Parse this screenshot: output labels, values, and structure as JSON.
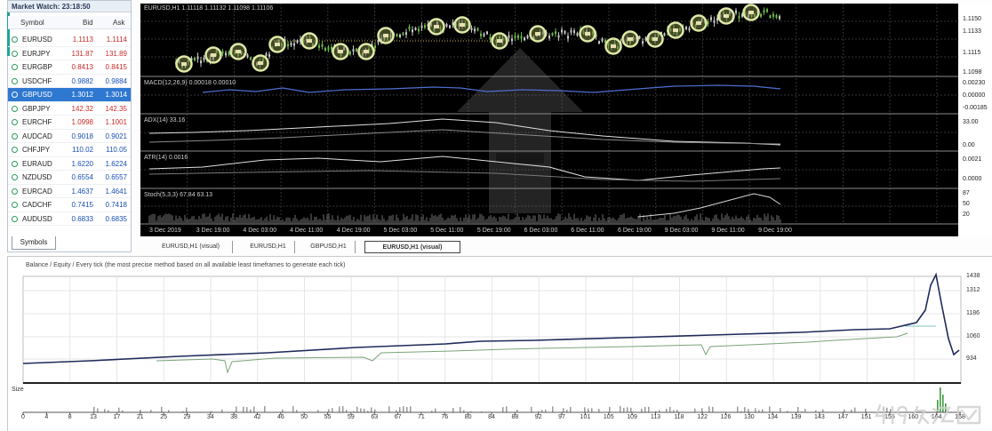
{
  "market_watch": {
    "title": "Market Watch: 23:18:50",
    "columns": {
      "symbol": "Symbol",
      "bid": "Bid",
      "ask": "Ask"
    },
    "colors": {
      "up": "#1a4fb5",
      "down": "#cc2b2b",
      "selected": "#2f78d1"
    },
    "icon_color": "#2e9b5b",
    "rows": [
      {
        "symbol": "EURUSD",
        "bid": "1.1113",
        "ask": "1.1114",
        "tick": "down"
      },
      {
        "symbol": "EURJPY",
        "bid": "131.87",
        "ask": "131.89",
        "tick": "down"
      },
      {
        "symbol": "EURGBP",
        "bid": "0.8413",
        "ask": "0.8415",
        "tick": "down"
      },
      {
        "symbol": "USDCHF",
        "bid": "0.9882",
        "ask": "0.9884",
        "tick": "up"
      },
      {
        "symbol": "GBPUSD",
        "bid": "1.3012",
        "ask": "1.3014",
        "tick": "up",
        "selected": true
      },
      {
        "symbol": "GBPJPY",
        "bid": "142.32",
        "ask": "142.35",
        "tick": "down"
      },
      {
        "symbol": "EURCHF",
        "bid": "1.0998",
        "ask": "1.1001",
        "tick": "down"
      },
      {
        "symbol": "AUDCAD",
        "bid": "0.9018",
        "ask": "0.9021",
        "tick": "up"
      },
      {
        "symbol": "CHFJPY",
        "bid": "110.02",
        "ask": "110.05",
        "tick": "up"
      },
      {
        "symbol": "EURAUD",
        "bid": "1.6220",
        "ask": "1.6224",
        "tick": "up"
      },
      {
        "symbol": "NZDUSD",
        "bid": "0.6554",
        "ask": "0.6557",
        "tick": "up"
      },
      {
        "symbol": "EURCAD",
        "bid": "1.4637",
        "ask": "1.4641",
        "tick": "up"
      },
      {
        "symbol": "CADCHF",
        "bid": "0.7415",
        "ask": "0.7418",
        "tick": "up"
      },
      {
        "symbol": "AUDUSD",
        "bid": "0.6833",
        "ask": "0.6835",
        "tick": "up"
      }
    ],
    "tab_label": "Symbols"
  },
  "chart": {
    "header": "EURUSD,H1  1.11118 1.11132 1.11098 1.11106",
    "indicators": [
      "MACD(12,26,9) 0.00018 0.00010",
      "ADX(14) 33.16",
      "ATR(14) 0.0016",
      "Stoch(5,3,3) 67.84 63.13"
    ],
    "price_axis": {
      "main": [
        "1.1150",
        "1.1133",
        "1.1115",
        "1.1098"
      ],
      "macd": [
        "0.00230",
        "0.00000",
        "-0.00185"
      ],
      "adx": [
        "33.00",
        "0.00"
      ],
      "atr": [
        "0.0021",
        "0.0000"
      ],
      "stoch": [
        "87",
        "50",
        "20"
      ]
    },
    "time_axis": [
      "3 Dec 2019",
      "3 Dec 19:00",
      "4 Dec 03:00",
      "4 Dec 11:00",
      "4 Dec 19:00",
      "5 Dec 03:00",
      "5 Dec 11:00",
      "5 Dec 19:00",
      "6 Dec 03:00",
      "6 Dec 11:00",
      "6 Dec 19:00",
      "9 Dec 03:00",
      "9 Dec 11:00",
      "9 Dec 19:00"
    ],
    "colors": {
      "background": "#000000",
      "candle": "#6db84a",
      "trade_marker": "#dfe8a8",
      "macd": "#4f6fd0",
      "grid": "#333333"
    }
  },
  "chart_tabs": [
    {
      "label": "EURUSD,H1 (visual)",
      "active": false
    },
    {
      "label": "EURUSD,H1",
      "active": false
    },
    {
      "label": "GBPUSD,H1",
      "active": false
    },
    {
      "label": "EURUSD,H1 (visual)",
      "active": true
    }
  ],
  "tester_graph": {
    "header": "Balance / Equity / Every tick (the most precise method based on all available least timeframes to generate each tick)",
    "y_axis": [
      "1438",
      "1312",
      "1186",
      "1060",
      "934"
    ],
    "size_label": "Size",
    "x_axis": [
      "0",
      "4",
      "8",
      "13",
      "17",
      "21",
      "25",
      "29",
      "34",
      "38",
      "42",
      "46",
      "50",
      "55",
      "59",
      "63",
      "67",
      "71",
      "76",
      "80",
      "84",
      "88",
      "92",
      "97",
      "101",
      "105",
      "109",
      "113",
      "118",
      "122",
      "126",
      "130",
      "134",
      "139",
      "143",
      "147",
      "151",
      "155",
      "160",
      "164",
      "168"
    ],
    "colors": {
      "balance": "#1f2a5a",
      "equity": "#7aa37a",
      "size_bar": "#3c9a3c"
    }
  },
  "watermark": "419外汇网"
}
